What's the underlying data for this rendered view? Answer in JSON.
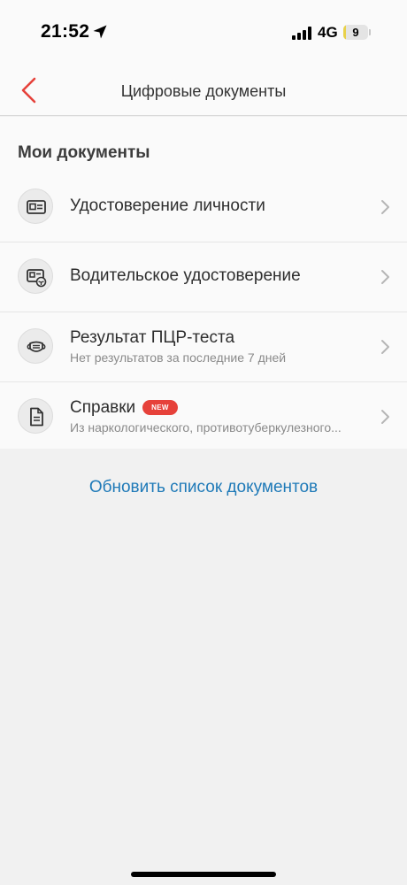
{
  "status_bar": {
    "time": "21:52",
    "network": "4G",
    "battery_level": "9",
    "battery_fraction": 0.09,
    "battery_color": "#e8d14a"
  },
  "header": {
    "title": "Цифровые документы",
    "back_icon": "chevron-left-icon",
    "accent_color": "#e6413a"
  },
  "section": {
    "title": "Мои документы"
  },
  "documents": [
    {
      "title": "Удостоверение личности",
      "subtitle": "",
      "icon": "id-card-icon"
    },
    {
      "title": "Водительское удостоверение",
      "subtitle": "",
      "icon": "driver-license-icon"
    },
    {
      "title": "Результат ПЦР-теста",
      "subtitle": "Нет результатов за последние 7 дней",
      "icon": "mask-icon"
    },
    {
      "title": "Справки",
      "subtitle": "Из наркологического, противотуберкулезного...",
      "icon": "document-icon",
      "badge": "NEW"
    }
  ],
  "refresh": {
    "label": "Обновить список документов",
    "color": "#1f7ab8"
  }
}
